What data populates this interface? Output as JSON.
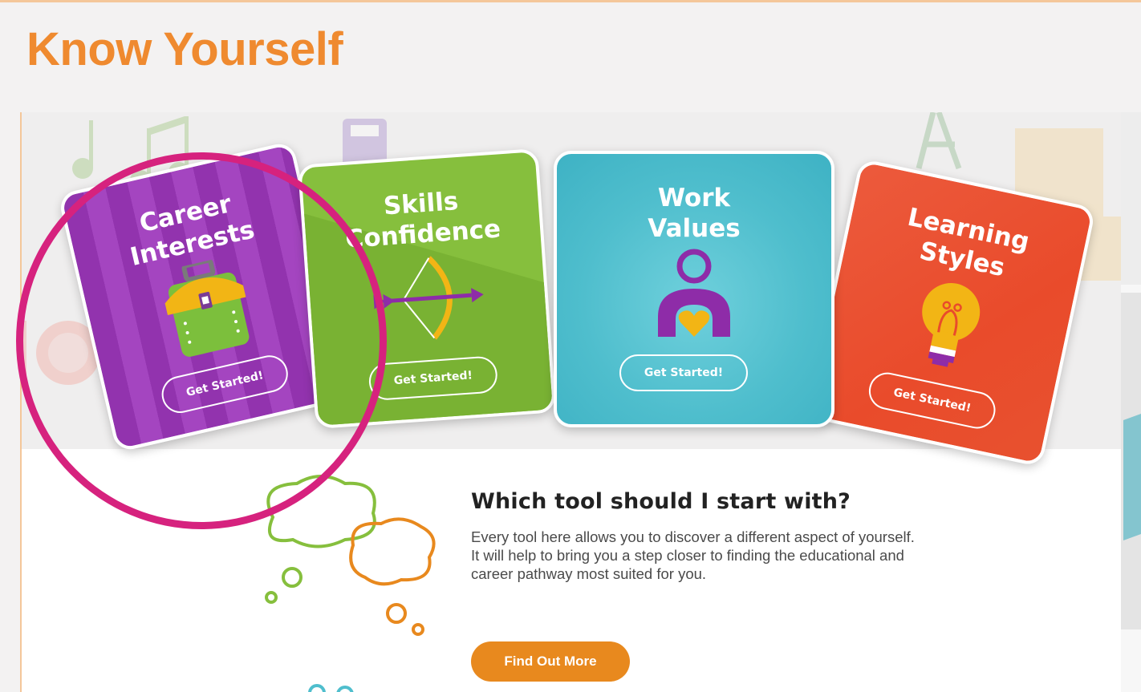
{
  "header": {
    "title": "Know Yourself"
  },
  "cards": [
    {
      "id": "career",
      "title": "Career\nInterests",
      "button": "Get Started!",
      "icon": "briefcase-icon",
      "color": "#9a3bb5"
    },
    {
      "id": "skills",
      "title": "Skills\nConfidence",
      "button": "Get Started!",
      "icon": "bow-and-arrow-icon",
      "color": "#86bf3d"
    },
    {
      "id": "work",
      "title": "Work\nValues",
      "button": "Get Started!",
      "icon": "person-heart-icon",
      "color": "#4fbecd"
    },
    {
      "id": "learning",
      "title": "Learning\nStyles",
      "button": "Get Started!",
      "icon": "lightbulb-icon",
      "color": "#e94b2b"
    }
  ],
  "info": {
    "heading": "Which tool should I start with?",
    "body": "Every tool here allows you to discover a different aspect of yourself. It will help to bring you a step closer to finding the educational and career pathway most suited for you.",
    "button": "Find Out More"
  },
  "colors": {
    "title": "#ef8a2f",
    "highlight": "#d6227e",
    "accent_button": "#e8891e"
  }
}
